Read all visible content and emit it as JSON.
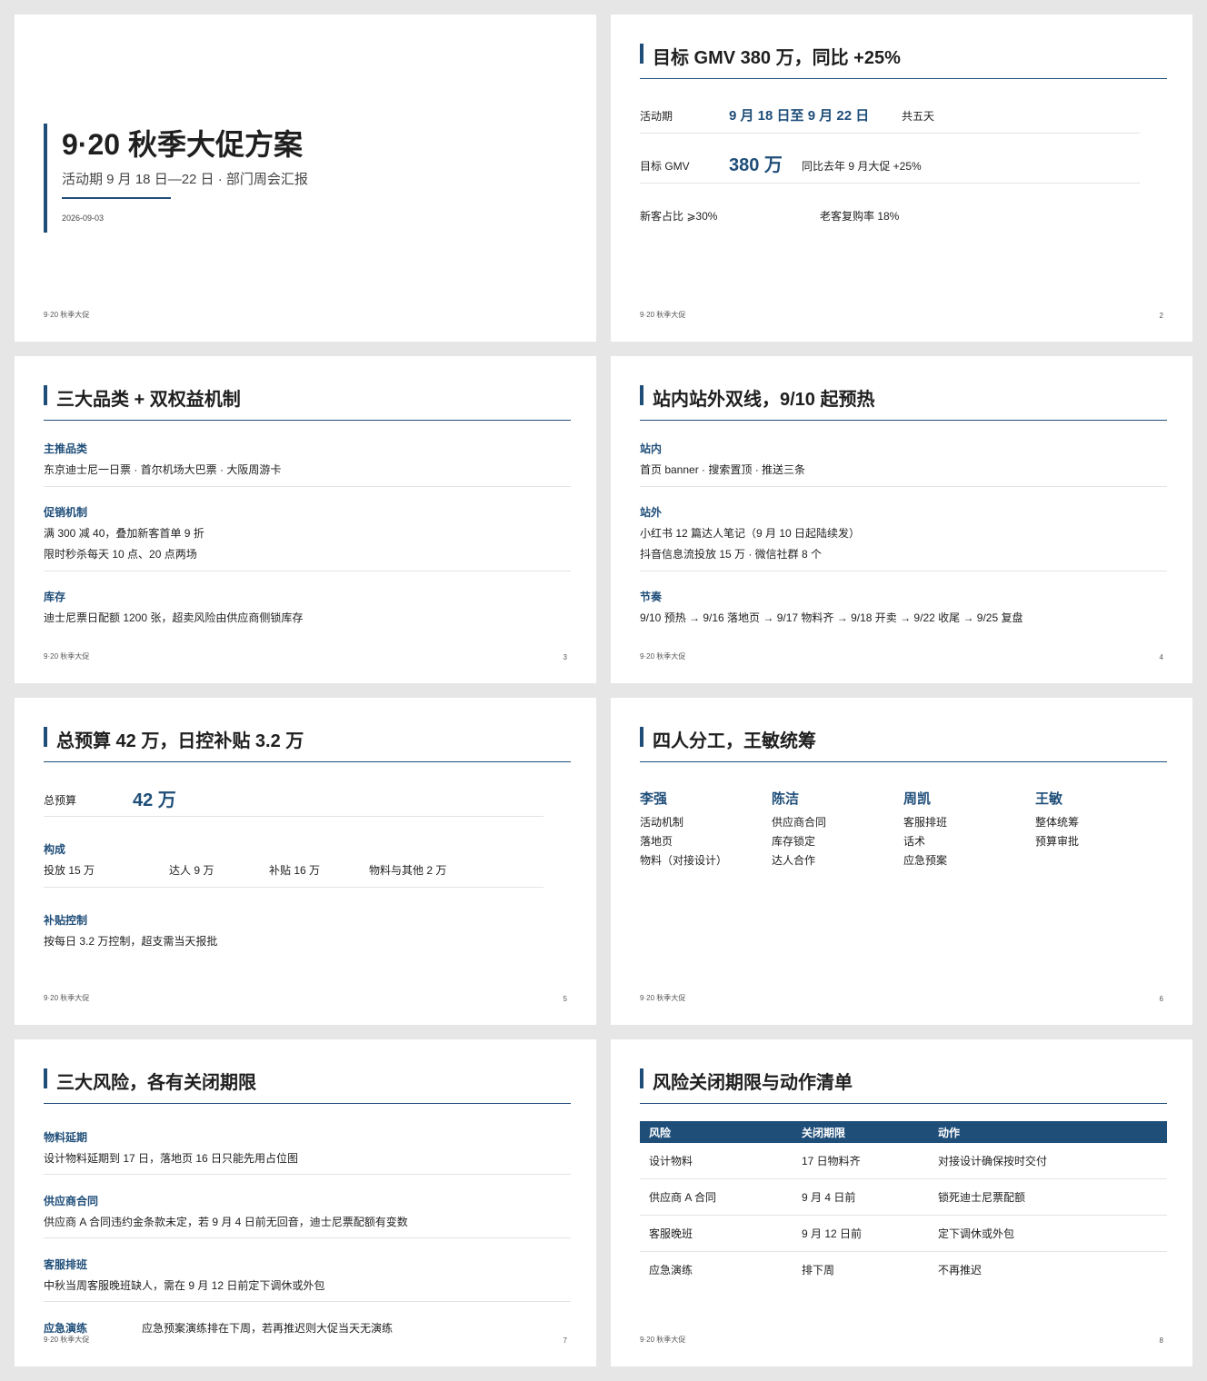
{
  "footer": "9·20 秋季大促",
  "slide1": {
    "title": "9·20 秋季大促方案",
    "subtitle": "活动期 9 月 18 日—22 日 · 部门周会汇报",
    "date": "2026-09-03"
  },
  "slide2": {
    "title": "目标 GMV 380 万，同比 +25%",
    "page": "2",
    "period_label": "活动期",
    "period_value": "9 月 18 日至 9 月 22 日",
    "period_note": "共五天",
    "gmv_label": "目标 GMV",
    "gmv_value": "380 万",
    "gmv_note": "同比去年 9 月大促 +25%",
    "new_ratio": "新客占比 ⩾30%",
    "repurchase": "老客复购率 18%"
  },
  "slide3": {
    "title": "三大品类 + 双权益机制",
    "page": "3",
    "sections": [
      {
        "label": "主推品类",
        "lines": [
          "东京迪士尼一日票 · 首尔机场大巴票 · 大阪周游卡"
        ]
      },
      {
        "label": "促销机制",
        "lines": [
          "满 300 减 40，叠加新客首单 9 折",
          "限时秒杀每天 10 点、20 点两场"
        ]
      },
      {
        "label": "库存",
        "lines": [
          "迪士尼票日配额 1200 张，超卖风险由供应商侧锁库存"
        ]
      }
    ]
  },
  "slide4": {
    "title": "站内站外双线，9/10 起预热",
    "page": "4",
    "sections": [
      {
        "label": "站内",
        "lines": [
          "首页 banner · 搜索置顶 · 推送三条"
        ]
      },
      {
        "label": "站外",
        "lines": [
          "小红书 12 篇达人笔记（9 月 10 日起陆续发）",
          "抖音信息流投放 15 万 · 微信社群 8 个"
        ]
      },
      {
        "label": "节奏",
        "lines": [
          "9/10 预热 → 9/16 落地页 → 9/17 物料齐 → 9/18 开卖 → 9/22 收尾 → 9/25 复盘"
        ]
      }
    ]
  },
  "slide5": {
    "title": "总预算 42 万，日控补贴 3.2 万",
    "page": "5",
    "budget_label": "总预算",
    "budget_value": "42 万",
    "composition_label": "构成",
    "composition": [
      "投放 15 万",
      "达人 9 万",
      "补贴 16 万",
      "物料与其他 2 万"
    ],
    "control_label": "补贴控制",
    "control_text": "按每日 3.2 万控制，超支需当天报批"
  },
  "slide6": {
    "title": "四人分工，王敏统筹",
    "page": "6",
    "people": [
      {
        "name": "李强",
        "tasks": [
          "活动机制",
          "落地页",
          "物料（对接设计）"
        ]
      },
      {
        "name": "陈洁",
        "tasks": [
          "供应商合同",
          "库存锁定",
          "达人合作"
        ]
      },
      {
        "name": "周凯",
        "tasks": [
          "客服排班",
          "话术",
          "应急预案"
        ]
      },
      {
        "name": "王敏",
        "tasks": [
          "整体统筹",
          "预算审批"
        ]
      }
    ]
  },
  "slide7": {
    "title": "三大风险，各有关闭期限",
    "page": "7",
    "risks": [
      {
        "label": "物料延期",
        "text": "设计物料延期到 17 日，落地页 16 日只能先用占位图"
      },
      {
        "label": "供应商合同",
        "text": "供应商 A 合同违约金条款未定，若 9 月 4 日前无回音，迪士尼票配额有变数"
      },
      {
        "label": "客服排班",
        "text": "中秋当周客服晚班缺人，需在 9 月 12 日前定下调休或外包"
      },
      {
        "label": "应急演练",
        "text": "应急预案演练排在下周，若再推迟则大促当天无演练"
      }
    ]
  },
  "slide8": {
    "title": "风险关闭期限与动作清单",
    "page": "8",
    "headers": [
      "风险",
      "关闭期限",
      "动作"
    ],
    "rows": [
      [
        "设计物料",
        "17 日物料齐",
        "对接设计确保按时交付"
      ],
      [
        "供应商 A 合同",
        "9 月 4 日前",
        "锁死迪士尼票配额"
      ],
      [
        "客服晚班",
        "9 月 12 日前",
        "定下调休或外包"
      ],
      [
        "应急演练",
        "排下周",
        "不再推迟"
      ]
    ]
  }
}
